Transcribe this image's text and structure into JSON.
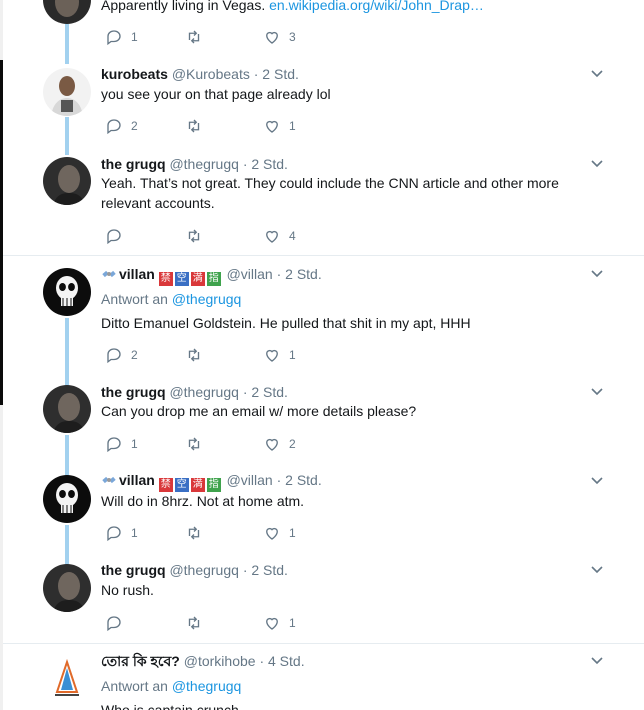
{
  "tweets": [
    {
      "text": "Apparently living in Vegas. ",
      "link": "en.wikipedia.org/wiki/John_Drap…",
      "actions": {
        "reply": "1",
        "retweet": "",
        "like": "3"
      }
    },
    {
      "name": "kurobeats",
      "handle": "@Kurobeats",
      "time": "· 2 Std.",
      "text": "you see your on that page already lol",
      "actions": {
        "reply": "2",
        "retweet": "",
        "like": "1"
      }
    },
    {
      "name": "the grugq",
      "handle": "@thegrugq",
      "time": "· 2 Std.",
      "text": "Yeah. That’s not great. They could include the CNN article and other more relevant accounts.",
      "actions": {
        "reply": "",
        "retweet": "",
        "like": "4"
      }
    },
    {
      "name": "villan",
      "handle": "@villan",
      "time": "· 2 Std.",
      "badges": [
        "禁",
        "空",
        "満",
        "指"
      ],
      "reply_prefix": "Antwort an ",
      "reply_to": "@thegrugq",
      "text": "Ditto Emanuel Goldstein. He pulled that shit in my apt, HHH",
      "actions": {
        "reply": "2",
        "retweet": "",
        "like": "1"
      }
    },
    {
      "name": "the grugq",
      "handle": "@thegrugq",
      "time": "· 2 Std.",
      "text": "Can you drop me an email w/ more details please?",
      "actions": {
        "reply": "1",
        "retweet": "",
        "like": "2"
      }
    },
    {
      "name": "villan",
      "handle": "@villan",
      "time": "· 2 Std.",
      "badges": [
        "禁",
        "空",
        "満",
        "指"
      ],
      "text": "Will do in 8hrz. Not at home atm.",
      "actions": {
        "reply": "1",
        "retweet": "",
        "like": "1"
      }
    },
    {
      "name": "the grugq",
      "handle": "@thegrugq",
      "time": "· 2 Std.",
      "text": "No rush.",
      "actions": {
        "reply": "",
        "retweet": "",
        "like": "1"
      }
    },
    {
      "name": "তোর কি হবে?",
      "handle": "@torkihobe",
      "time": "· 4 Std.",
      "reply_prefix": "Antwort an ",
      "reply_to": "@thegrugq",
      "text": "Who is captain crunch"
    }
  ],
  "colors": {
    "accent": "#1b95e0",
    "thread": "#a2d1ef",
    "muted": "#657786",
    "badges": [
      "#d9383a",
      "#3a6fc4",
      "#d9383a",
      "#3fa34d"
    ]
  }
}
